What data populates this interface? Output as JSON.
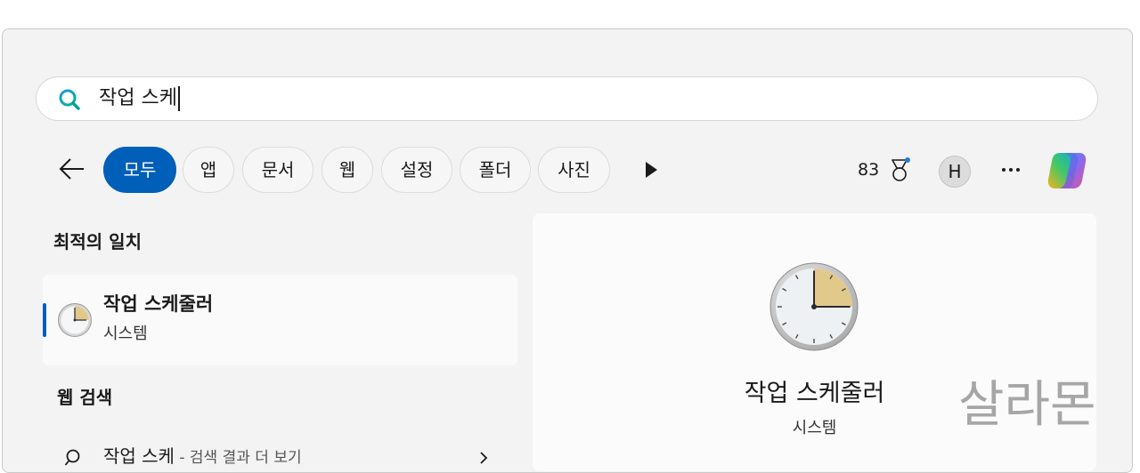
{
  "search": {
    "query": "작업 스케"
  },
  "filters": [
    {
      "label": "모두",
      "active": true
    },
    {
      "label": "앱"
    },
    {
      "label": "문서"
    },
    {
      "label": "웹"
    },
    {
      "label": "설정"
    },
    {
      "label": "폴더"
    },
    {
      "label": "사진"
    }
  ],
  "toolbar": {
    "points": "83",
    "avatar_initial": "H"
  },
  "best_match": {
    "section_title": "최적의 일치",
    "title": "작업 스케줄러",
    "subtitle": "시스템"
  },
  "web_search": {
    "section_title": "웹 검색",
    "query": "작업 스케",
    "hint": " - 검색 결과 더 보기"
  },
  "detail": {
    "title": "작업 스케줄러",
    "subtitle": "시스템"
  },
  "watermark": "살라몬",
  "colors": {
    "accent": "#005fb8",
    "clock_wedge": "#e1c98c"
  },
  "icons": [
    "search-icon",
    "back-arrow-icon",
    "play-icon",
    "medal-icon",
    "more-icon",
    "copilot-icon",
    "clock-icon",
    "chevron-right-icon"
  ]
}
